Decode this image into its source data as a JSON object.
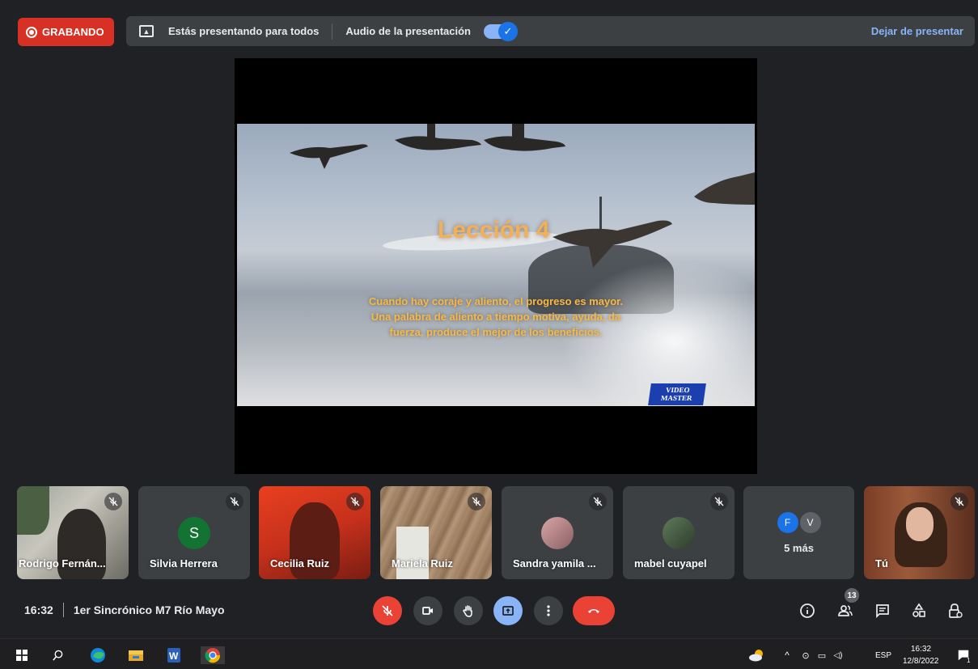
{
  "top_bar": {
    "recording_label": "GRABANDO",
    "presenting_text": "Estás presentando para todos",
    "audio_label": "Audio de la presentación",
    "audio_toggle_on": true,
    "stop_presenting": "Dejar de presentar"
  },
  "slide": {
    "title": "Lección 4",
    "quote": "Cuando hay coraje y aliento, el progreso es mayor. Una palabra de aliento a tiempo motiva, ayuda, da fuerza, produce el mejor de los beneficios.",
    "logo_line1": "VIDEO",
    "logo_line2": "MASTER"
  },
  "participants": [
    {
      "name": "Rodrigo Fernán...",
      "type": "video"
    },
    {
      "name": "Silvia Herrera",
      "type": "avatar",
      "initial": "S",
      "color": "#137333"
    },
    {
      "name": "Cecilia Ruiz",
      "type": "video"
    },
    {
      "name": "Mariela Ruiz",
      "type": "video"
    },
    {
      "name": "Sandra yamila ...",
      "type": "photo"
    },
    {
      "name": "mabel cuyapel",
      "type": "photo"
    },
    {
      "name": "5 más",
      "type": "more",
      "initials": [
        "F",
        "V"
      ]
    },
    {
      "name": "Tú",
      "type": "video"
    }
  ],
  "bottom": {
    "time": "16:32",
    "meeting_name": "1er Sincrónico M7 Río Mayo",
    "people_count": "13",
    "colors": {
      "red": "#ea4335",
      "blue": "#8ab4f8",
      "grey": "#3c4043"
    }
  },
  "taskbar": {
    "language": "ESP",
    "time": "16:32",
    "date": "12/8/2022",
    "notification_count": "1"
  }
}
